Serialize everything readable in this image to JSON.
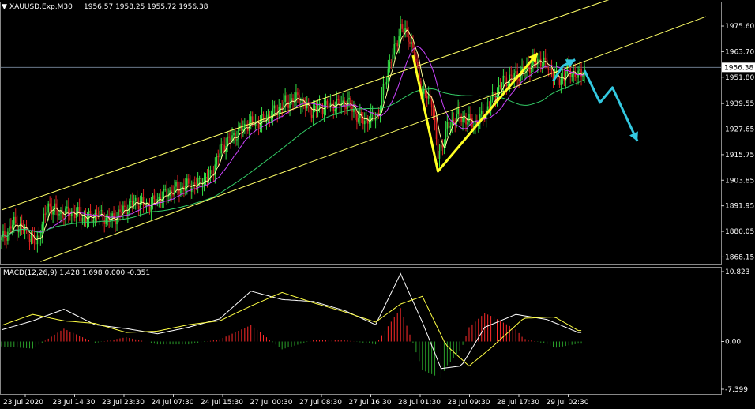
{
  "chart_data": [
    {
      "type": "candlestick",
      "symbol": "XAUUSD.Exp,M30",
      "ohlc_text": "1956.57 1958.25 1955.72 1956.38",
      "current_price": 1956.38,
      "ylim": [
        1865.0,
        1987.0
      ],
      "yticks": [
        "1975.60",
        "1963.70",
        "1951.80",
        "1939.55",
        "1927.65",
        "1915.75",
        "1903.85",
        "1891.95",
        "1880.05",
        "1868.15"
      ],
      "current_price_label": "1956.38",
      "xticks": [
        "23 Jul 2020",
        "23 Jul 14:30",
        "23 Jul 23:30",
        "24 Jul 07:30",
        "24 Jul 15:30",
        "27 Jul 00:30",
        "27 Jul 08:30",
        "27 Jul 16:30",
        "28 Jul 01:30",
        "28 Jul 09:30",
        "28 Jul 17:30",
        "29 Jul 02:30"
      ],
      "close_path": [
        [
          0,
          1876
        ],
        [
          8,
          1884
        ],
        [
          16,
          1880
        ],
        [
          22,
          1874
        ],
        [
          30,
          1892
        ],
        [
          38,
          1888
        ],
        [
          46,
          1889
        ],
        [
          54,
          1886
        ],
        [
          62,
          1888
        ],
        [
          70,
          1885
        ],
        [
          78,
          1890
        ],
        [
          86,
          1894
        ],
        [
          94,
          1892
        ],
        [
          102,
          1896
        ],
        [
          110,
          1899
        ],
        [
          118,
          1901
        ],
        [
          126,
          1902
        ],
        [
          134,
          1906
        ],
        [
          142,
          1920
        ],
        [
          150,
          1925
        ],
        [
          158,
          1930
        ],
        [
          166,
          1931
        ],
        [
          174,
          1935
        ],
        [
          182,
          1940
        ],
        [
          190,
          1942
        ],
        [
          198,
          1936
        ],
        [
          206,
          1938
        ],
        [
          214,
          1939
        ],
        [
          222,
          1940
        ],
        [
          230,
          1932
        ],
        [
          236,
          1932
        ],
        [
          242,
          1935
        ],
        [
          248,
          1956
        ],
        [
          252,
          1964
        ],
        [
          256,
          1975
        ],
        [
          262,
          1970
        ],
        [
          266,
          1958
        ],
        [
          270,
          1944
        ],
        [
          276,
          1941
        ],
        [
          280,
          1915
        ],
        [
          286,
          1928
        ],
        [
          292,
          1934
        ],
        [
          298,
          1932
        ],
        [
          304,
          1930
        ],
        [
          310,
          1935
        ],
        [
          316,
          1943
        ],
        [
          322,
          1950
        ],
        [
          328,
          1952
        ],
        [
          334,
          1954
        ],
        [
          340,
          1958
        ],
        [
          346,
          1960
        ],
        [
          352,
          1955
        ],
        [
          358,
          1950
        ],
        [
          364,
          1955
        ],
        [
          370,
          1952
        ],
        [
          374,
          1956
        ]
      ],
      "trendlines": [
        {
          "color": "#ffff66",
          "from": [
            0,
            1890
          ],
          "to": [
            410,
            1993
          ]
        },
        {
          "color": "#ffff66",
          "from": [
            25,
            1866
          ],
          "to": [
            452,
            1980
          ]
        }
      ],
      "wave_arrows": [
        {
          "color": "#ffff22",
          "points": [
            [
              264,
              1962
            ],
            [
              280,
              1908
            ],
            [
              344,
              1963
            ]
          ]
        },
        {
          "color": "#33c8e0",
          "points": [
            [
              354,
              1950
            ],
            [
              360,
              1957
            ],
            [
              368,
              1960
            ]
          ]
        },
        {
          "color": "#33c8e0",
          "points": [
            [
              374,
              1955
            ],
            [
              384,
              1940
            ],
            [
              392,
              1947
            ],
            [
              408,
              1922
            ]
          ]
        }
      ],
      "ma_colors": {
        "fast": "#ffff99",
        "mid": "#cc44ff",
        "slow": "#33cc66"
      }
    },
    {
      "type": "macd",
      "title": "MACD(12,26,9) 1.428 1.698 0.000 -0.351",
      "ylim": [
        -7.399,
        10.823
      ],
      "yticks": [
        "10.823",
        "0.00",
        "-7.399"
      ],
      "macd_line": [
        [
          0,
          1.8
        ],
        [
          20,
          3.2
        ],
        [
          40,
          5.0
        ],
        [
          60,
          2.6
        ],
        [
          80,
          2.0
        ],
        [
          100,
          1.2
        ],
        [
          120,
          2.2
        ],
        [
          140,
          3.5
        ],
        [
          160,
          7.8
        ],
        [
          180,
          6.5
        ],
        [
          200,
          6.2
        ],
        [
          220,
          4.8
        ],
        [
          240,
          2.6
        ],
        [
          256,
          10.5
        ],
        [
          270,
          3.0
        ],
        [
          282,
          -4.2
        ],
        [
          295,
          -3.8
        ],
        [
          310,
          2.2
        ],
        [
          330,
          4.2
        ],
        [
          350,
          3.4
        ],
        [
          370,
          1.4
        ]
      ],
      "signal_line": [
        [
          0,
          2.5
        ],
        [
          20,
          4.2
        ],
        [
          40,
          3.2
        ],
        [
          60,
          2.8
        ],
        [
          80,
          1.4
        ],
        [
          100,
          1.6
        ],
        [
          120,
          2.6
        ],
        [
          140,
          3.2
        ],
        [
          160,
          5.5
        ],
        [
          180,
          7.6
        ],
        [
          200,
          6.0
        ],
        [
          220,
          4.6
        ],
        [
          240,
          3.0
        ],
        [
          256,
          5.8
        ],
        [
          270,
          7.0
        ],
        [
          285,
          -0.5
        ],
        [
          300,
          -3.8
        ],
        [
          315,
          -0.8
        ],
        [
          335,
          3.6
        ],
        [
          355,
          3.8
        ],
        [
          370,
          1.7
        ]
      ],
      "histogram_up_color": "#ff2a2a",
      "histogram_down_color": "#2aa02a"
    }
  ]
}
